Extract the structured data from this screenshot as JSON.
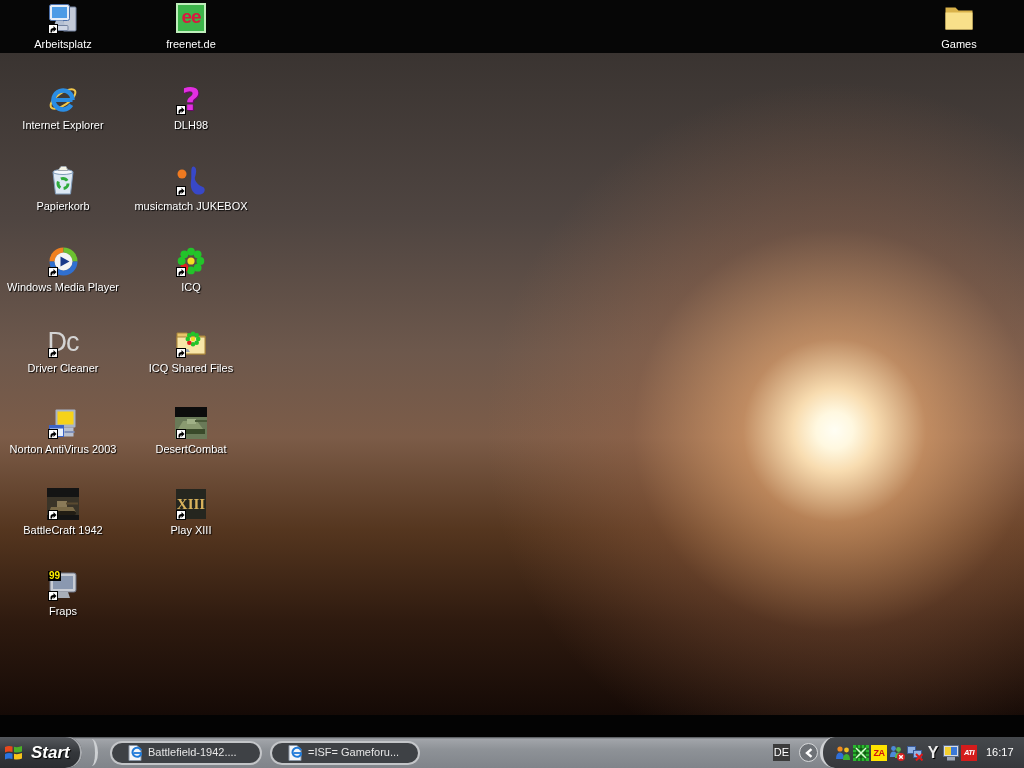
{
  "desktop": {
    "icons": [
      {
        "label": "Arbeitsplatz",
        "shortcut": true
      },
      {
        "label": "Internet Explorer",
        "shortcut": false
      },
      {
        "label": "Papierkorb",
        "shortcut": false
      },
      {
        "label": "Windows Media Player",
        "shortcut": true
      },
      {
        "label": "Driver Cleaner",
        "shortcut": true,
        "icon_text": "Dc"
      },
      {
        "label": "Norton AntiVirus 2003",
        "shortcut": true
      },
      {
        "label": "BattleCraft 1942",
        "shortcut": true
      },
      {
        "label": "Fraps",
        "shortcut": true,
        "icon_text": "99"
      },
      {
        "label": "freenet.de",
        "shortcut": false,
        "icon_text": "ee"
      },
      {
        "label": "DLH98",
        "shortcut": true,
        "icon_text": "?"
      },
      {
        "label": "musicmatch JUKEBOX",
        "shortcut": true
      },
      {
        "label": "ICQ",
        "shortcut": true
      },
      {
        "label": "ICQ Shared Files",
        "shortcut": true
      },
      {
        "label": "DesertCombat",
        "shortcut": true
      },
      {
        "label": "Play XIII",
        "shortcut": true,
        "icon_text": "XIII"
      }
    ],
    "top_right_icons": [
      {
        "label": "Games",
        "shortcut": false
      }
    ]
  },
  "taskbar": {
    "start_button": "Start",
    "tasks": [
      {
        "label": "Battlefield-1942....",
        "selected": false
      },
      {
        "label": "=ISF= Gameforu...",
        "selected": false
      }
    ],
    "language": "DE",
    "tray": {
      "icon_texts": [
        "ZA",
        "Y",
        "ATI"
      ],
      "clock": "16:17"
    }
  }
}
